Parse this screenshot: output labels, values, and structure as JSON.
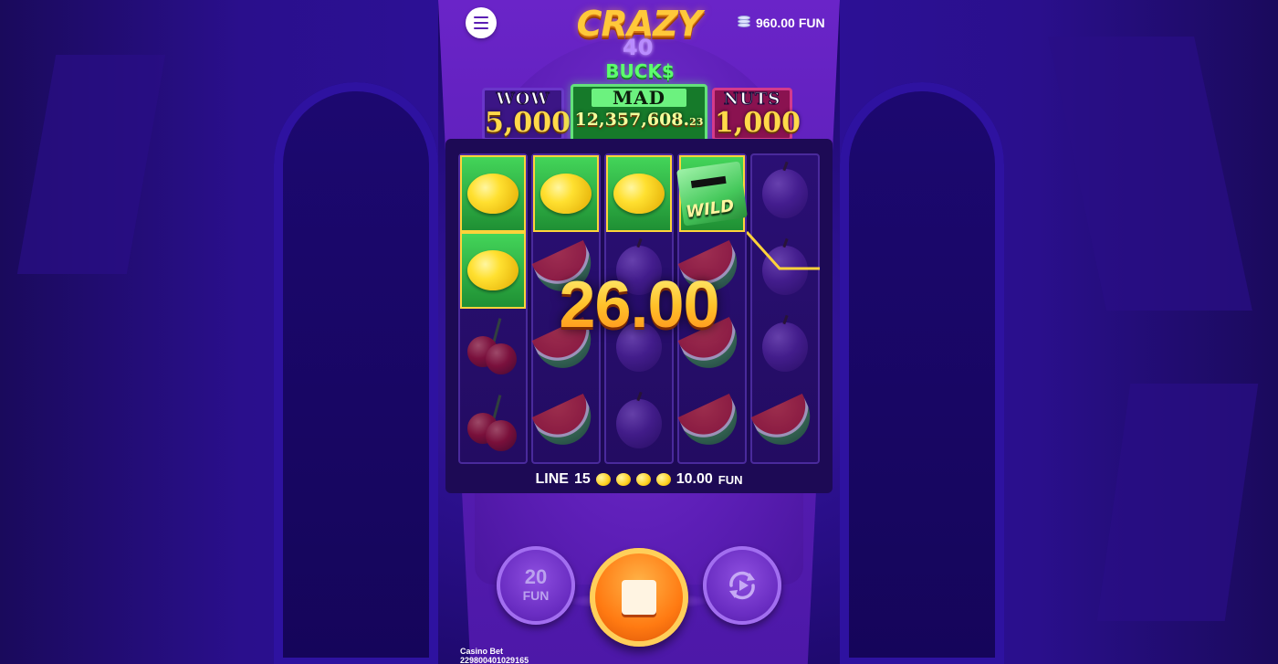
{
  "header": {
    "balance_value": "960.00",
    "balance_unit": "FUN"
  },
  "logo": {
    "line1": "CRAZY",
    "line2": "40",
    "line3": "BUCK$"
  },
  "jackpots": [
    {
      "name": "WOW",
      "value": "5,000"
    },
    {
      "name": "MAD",
      "value": "12,357,608.",
      "cents": "23"
    },
    {
      "name": "NUTS",
      "value": "1,000"
    }
  ],
  "reels": {
    "symbol_icons": [
      "lemon",
      "plum",
      "watermelon",
      "cherries",
      "wild"
    ],
    "wild_label": "WILD"
  },
  "win": {
    "amount": "26.00"
  },
  "line_info": {
    "label": "LINE",
    "number": "15",
    "amount": "10.00",
    "unit": "FUN"
  },
  "controls": {
    "bet_amount": "20",
    "bet_unit": "FUN"
  },
  "footer": {
    "operator": "Casino Bet",
    "round_id": "229800401029165"
  },
  "colors": {
    "background": "#1f0a6e",
    "cabinet": "#5b1fb6",
    "win_highlight": "#44d65a",
    "spin_button": "#ff7a12",
    "win_text": "#ffd84a"
  }
}
